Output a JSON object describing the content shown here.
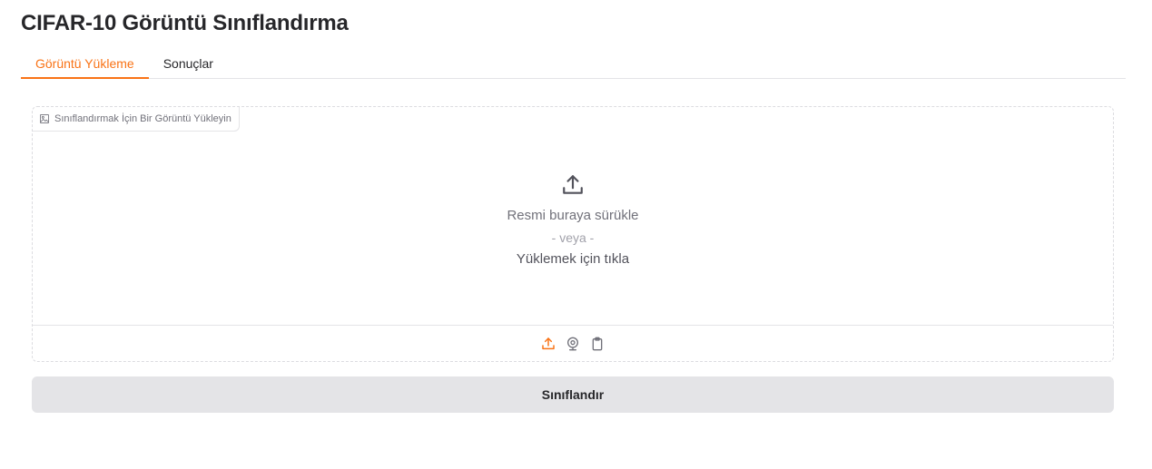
{
  "page": {
    "title": "CIFAR-10 Görüntü Sınıflandırma"
  },
  "tabs": [
    {
      "label": "Görüntü Yükleme",
      "active": true
    },
    {
      "label": "Sonuçlar",
      "active": false
    }
  ],
  "upload": {
    "label": "Sınıflandırmak İçin Bir Görüntü Yükleyin",
    "label_icon": "image-icon",
    "drop_text": "Resmi buraya sürükle",
    "or_text": "- veya -",
    "click_text": "Yüklemek için tıkla",
    "sources": [
      {
        "icon": "upload-icon",
        "active": true
      },
      {
        "icon": "webcam-icon",
        "active": false
      },
      {
        "icon": "clipboard-icon",
        "active": false
      }
    ]
  },
  "actions": {
    "submit_label": "Sınıflandır"
  },
  "colors": {
    "accent": "#f97316",
    "button_bg": "#e4e4e7",
    "text": "#27272a",
    "muted": "#71717a"
  }
}
